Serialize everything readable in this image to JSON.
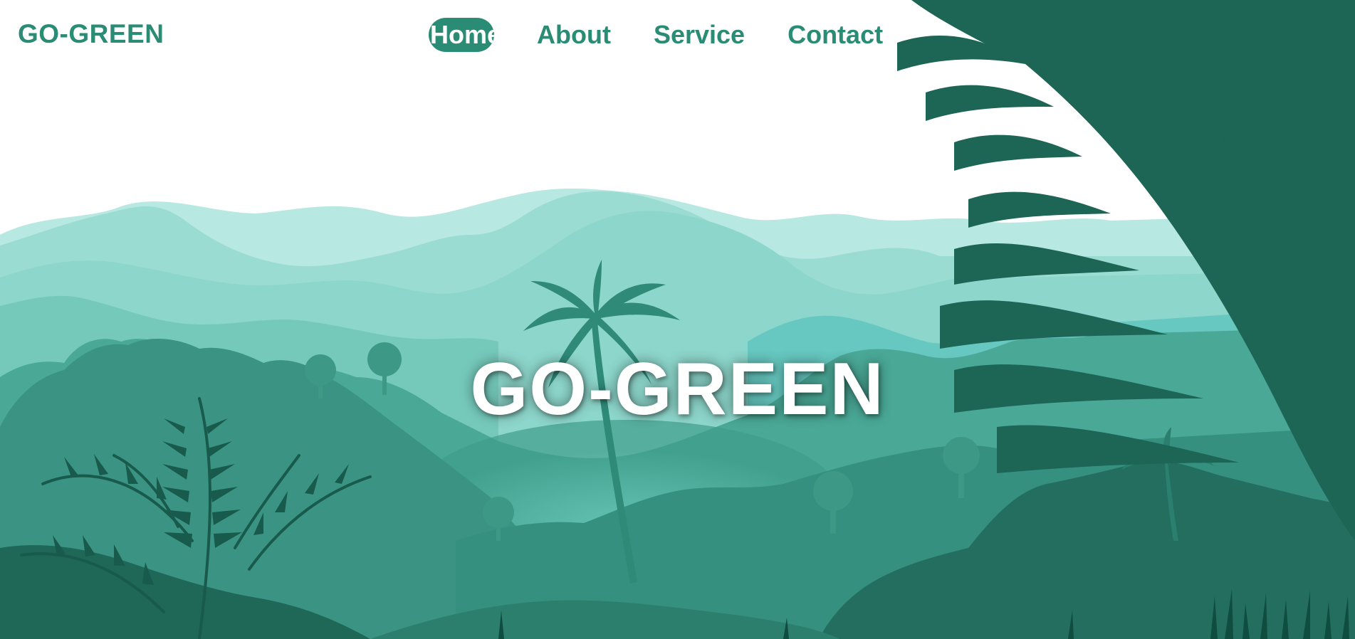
{
  "nav": {
    "brand": "GO-GREEN",
    "links": [
      {
        "label": "Home",
        "active": true
      },
      {
        "label": "About",
        "active": false
      },
      {
        "label": "Service",
        "active": false
      },
      {
        "label": "Contact",
        "active": false
      }
    ]
  },
  "hero": {
    "title": "GO-GREEN"
  },
  "colors": {
    "brand": "#2b8c76",
    "far_hills": "#b3e6df",
    "mid_hills": "#8ed9cf",
    "near_hills": "#5fb8a8",
    "forest": "#3f9d8b",
    "foreground": "#1e6b5a",
    "dark_foliage": "#0f4d40"
  },
  "icons": [
    "fern-leaf-icon",
    "palm-tree-icon",
    "tree-icon",
    "grass-icon"
  ]
}
